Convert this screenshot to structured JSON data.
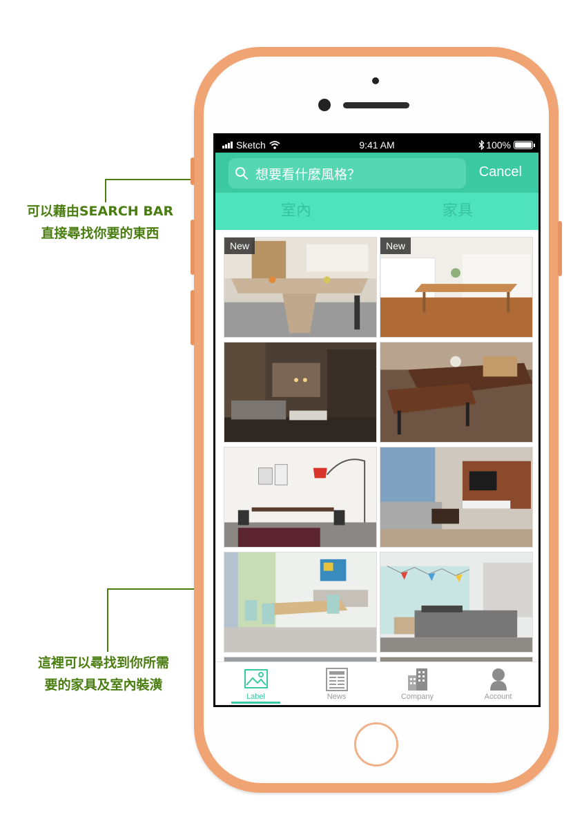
{
  "annotations": {
    "search_note": [
      "可以藉由SEARCH BAR",
      "直接尋找你要的東西"
    ],
    "grid_note": [
      "這裡可以尋找到你所需",
      "要的家具及室內裝潢"
    ]
  },
  "status_bar": {
    "carrier": "Sketch",
    "time": "9:41 AM",
    "battery": "100%"
  },
  "search": {
    "placeholder": "想要看什麼風格？",
    "cancel_label": "Cancel"
  },
  "tabs": [
    {
      "label": "室內"
    },
    {
      "label": "家具"
    }
  ],
  "gallery": {
    "badge_label": "New",
    "items": [
      {
        "scene": "dining-table-wood-kitchen",
        "badge": true
      },
      {
        "scene": "wood-table-kitchen-floor",
        "badge": true
      },
      {
        "scene": "dark-living-room-shelves",
        "badge": false
      },
      {
        "scene": "dining-set-bench",
        "badge": false
      },
      {
        "scene": "white-dining-red-lamp",
        "badge": false
      },
      {
        "scene": "living-room-tv-wall",
        "badge": false
      },
      {
        "scene": "bright-dining-mint-chairs",
        "badge": false
      },
      {
        "scene": "bedroom-bunting",
        "badge": false
      }
    ]
  },
  "tab_bar": [
    {
      "label": "Label",
      "icon": "picture-icon",
      "active": true
    },
    {
      "label": "News",
      "icon": "newspaper-icon",
      "active": false
    },
    {
      "label": "Company",
      "icon": "building-icon",
      "active": false
    },
    {
      "label": "Account",
      "icon": "user-icon",
      "active": false
    }
  ],
  "colors": {
    "accent": "#3bc9a2",
    "tab_bg": "#4fe3bd",
    "phone_frame": "#f0a474",
    "annotation": "#4a7d10"
  }
}
